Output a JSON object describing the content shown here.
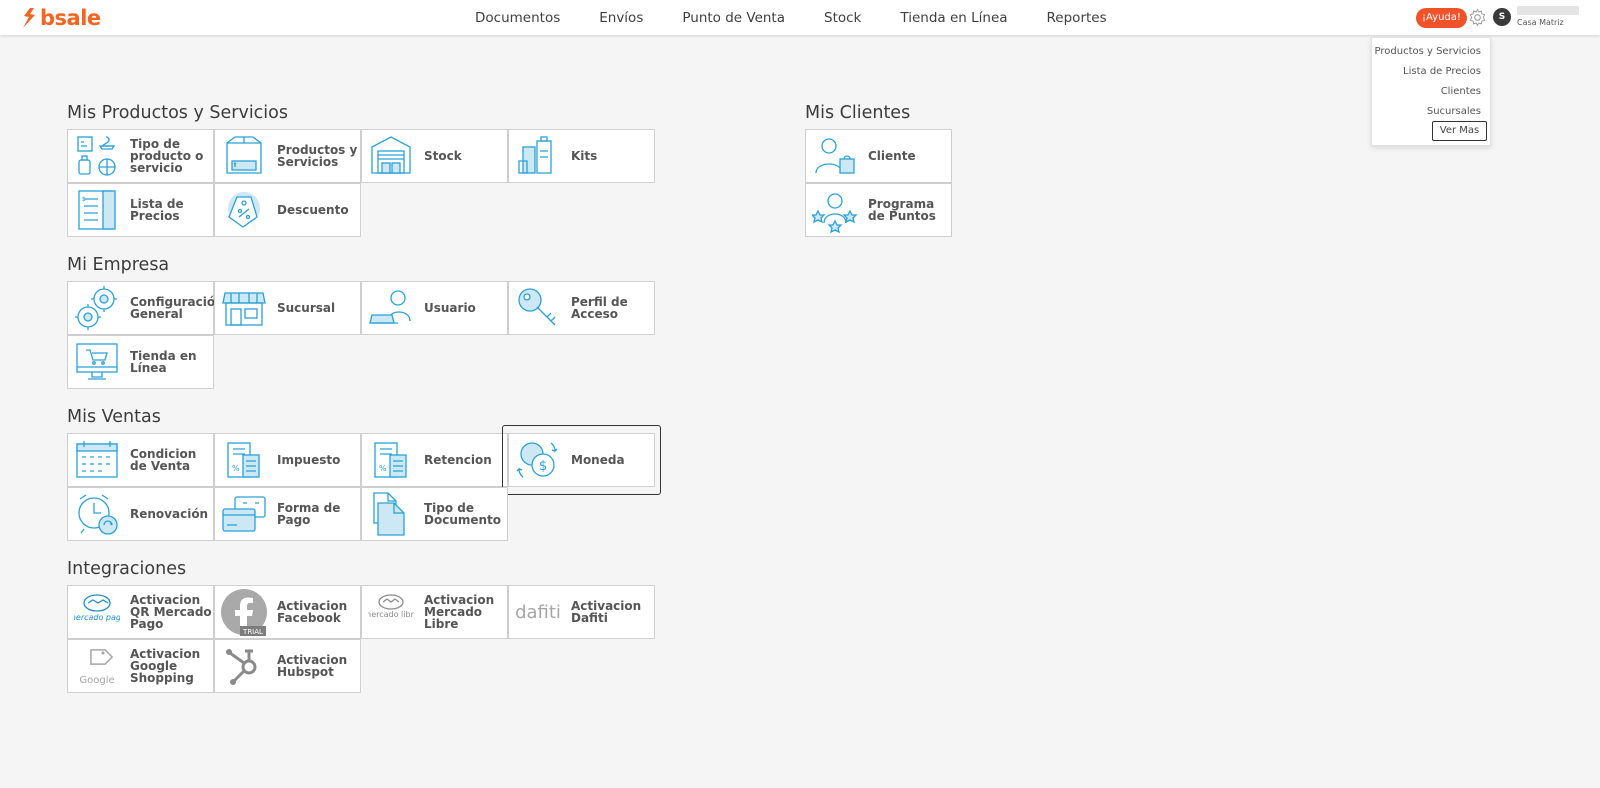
{
  "brand": {
    "name": "bsale",
    "color": "#f26522"
  },
  "nav": {
    "items": [
      "Documentos",
      "Envíos",
      "Punto de Venta",
      "Stock",
      "Tienda en Línea",
      "Reportes"
    ]
  },
  "header": {
    "help_label": "¡Ayuda!",
    "avatar_letter": "S",
    "branch": "Casa Matriz",
    "settings_icon": "gear-icon"
  },
  "settings_menu": {
    "items": [
      "Productos y Servicios",
      "Lista de Precios",
      "Clientes",
      "Sucursales"
    ],
    "more_label": "Ver Mas"
  },
  "sections": {
    "productos": {
      "title": "Mis Productos y Servicios",
      "tiles": [
        "Tipo de producto o servicio",
        "Productos y Servicios",
        "Stock",
        "Kits",
        "Lista de Precios",
        "Descuento"
      ]
    },
    "clientes": {
      "title": "Mis Clientes",
      "tiles": [
        "Cliente",
        "Programa de Puntos"
      ]
    },
    "empresa": {
      "title": "Mi Empresa",
      "tiles": [
        "Configuración General",
        "Sucursal",
        "Usuario",
        "Perfil de Acceso",
        "Tienda en Línea"
      ]
    },
    "ventas": {
      "title": "Mis Ventas",
      "tiles": [
        "Condicion de Venta",
        "Impuesto",
        "Retencion",
        "Moneda",
        "Renovación",
        "Forma de Pago",
        "Tipo de Documento"
      ]
    },
    "integraciones": {
      "title": "Integraciones",
      "tiles": [
        "Activacion QR Mercado Pago",
        "Activacion Facebook",
        "Activacion Mercado Libre",
        "Activacion Dafiti",
        "Activacion Google Shopping",
        "Activacion Hubspot"
      ],
      "logos": {
        "mercado_pago": "mercado pago",
        "facebook_badge": "TRIAL",
        "mercado_libre": "mercado libre",
        "dafiti": "dafiti",
        "google": "Google"
      }
    }
  },
  "colors": {
    "accent_icon": "#2aa0d6",
    "help_button": "#f0532a"
  }
}
